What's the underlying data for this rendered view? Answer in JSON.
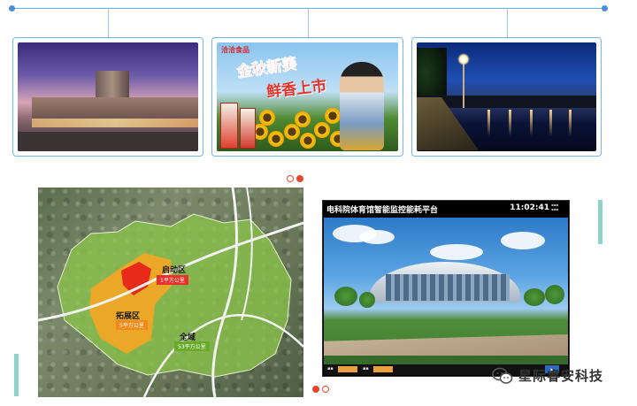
{
  "gallery": {
    "ad_brand": "洽洽食品",
    "ad_slogan_line1": "金秋新葵",
    "ad_slogan_line2": "鲜香上市"
  },
  "map": {
    "zone_start_label": "启动区",
    "zone_start_area": "1平方公里",
    "zone_expand_label": "拓展区",
    "zone_expand_area": "5平方公里",
    "zone_all_label": "全域",
    "zone_all_area": "53平方公里"
  },
  "monitor": {
    "title": "电科院体育馆智能监控能耗平台",
    "clock": "11:02:41"
  },
  "watermark": {
    "text": "星际睿安科技"
  },
  "colors": {
    "accent_blue": "#4a90d9",
    "pager_red": "#e8472e",
    "side_bar": "#8fd3c8"
  }
}
